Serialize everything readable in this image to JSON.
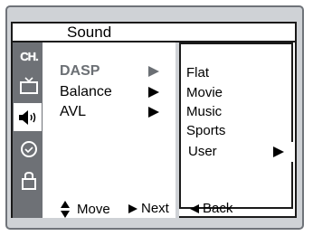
{
  "menu": {
    "title": "Sound",
    "side_icons": [
      {
        "name": "ch-icon",
        "label": "CH."
      },
      {
        "name": "tv-icon",
        "label": ""
      },
      {
        "name": "speaker-icon",
        "label": ""
      },
      {
        "name": "clock-icon",
        "label": ""
      },
      {
        "name": "lock-icon",
        "label": ""
      }
    ],
    "active_icon": "speaker-icon",
    "items": [
      {
        "label": "DASP",
        "highlighted": true
      },
      {
        "label": "Balance",
        "highlighted": false
      },
      {
        "label": "AVL",
        "highlighted": false
      }
    ],
    "options": [
      "Flat",
      "Movie",
      "Music",
      "Sports",
      "User"
    ],
    "selected_option": "User"
  },
  "footer": {
    "move_label": "Move",
    "next_label": "Next",
    "back_label": "Back"
  },
  "colors": {
    "frame_bg": "#cfd2d6",
    "sidebar_bg": "#6e7176",
    "dim_text": "#6b6f74"
  }
}
